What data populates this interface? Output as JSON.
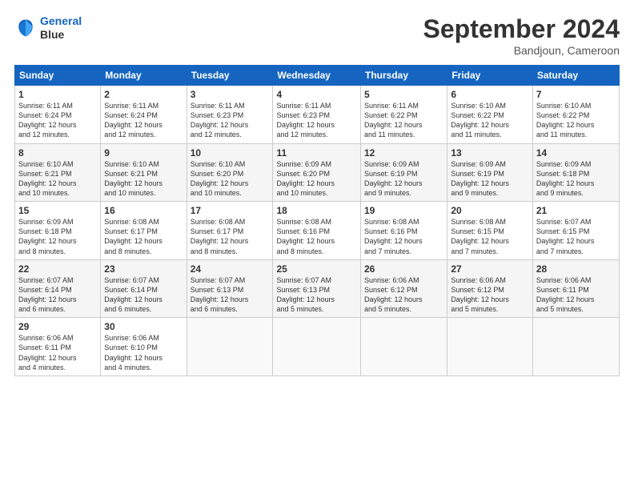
{
  "logo": {
    "line1": "General",
    "line2": "Blue"
  },
  "title": "September 2024",
  "subtitle": "Bandjoun, Cameroon",
  "days_of_week": [
    "Sunday",
    "Monday",
    "Tuesday",
    "Wednesday",
    "Thursday",
    "Friday",
    "Saturday"
  ],
  "weeks": [
    [
      {
        "day": "1",
        "info": "Sunrise: 6:11 AM\nSunset: 6:24 PM\nDaylight: 12 hours\nand 12 minutes."
      },
      {
        "day": "2",
        "info": "Sunrise: 6:11 AM\nSunset: 6:24 PM\nDaylight: 12 hours\nand 12 minutes."
      },
      {
        "day": "3",
        "info": "Sunrise: 6:11 AM\nSunset: 6:23 PM\nDaylight: 12 hours\nand 12 minutes."
      },
      {
        "day": "4",
        "info": "Sunrise: 6:11 AM\nSunset: 6:23 PM\nDaylight: 12 hours\nand 12 minutes."
      },
      {
        "day": "5",
        "info": "Sunrise: 6:11 AM\nSunset: 6:22 PM\nDaylight: 12 hours\nand 11 minutes."
      },
      {
        "day": "6",
        "info": "Sunrise: 6:10 AM\nSunset: 6:22 PM\nDaylight: 12 hours\nand 11 minutes."
      },
      {
        "day": "7",
        "info": "Sunrise: 6:10 AM\nSunset: 6:22 PM\nDaylight: 12 hours\nand 11 minutes."
      }
    ],
    [
      {
        "day": "8",
        "info": "Sunrise: 6:10 AM\nSunset: 6:21 PM\nDaylight: 12 hours\nand 10 minutes."
      },
      {
        "day": "9",
        "info": "Sunrise: 6:10 AM\nSunset: 6:21 PM\nDaylight: 12 hours\nand 10 minutes."
      },
      {
        "day": "10",
        "info": "Sunrise: 6:10 AM\nSunset: 6:20 PM\nDaylight: 12 hours\nand 10 minutes."
      },
      {
        "day": "11",
        "info": "Sunrise: 6:09 AM\nSunset: 6:20 PM\nDaylight: 12 hours\nand 10 minutes."
      },
      {
        "day": "12",
        "info": "Sunrise: 6:09 AM\nSunset: 6:19 PM\nDaylight: 12 hours\nand 9 minutes."
      },
      {
        "day": "13",
        "info": "Sunrise: 6:09 AM\nSunset: 6:19 PM\nDaylight: 12 hours\nand 9 minutes."
      },
      {
        "day": "14",
        "info": "Sunrise: 6:09 AM\nSunset: 6:18 PM\nDaylight: 12 hours\nand 9 minutes."
      }
    ],
    [
      {
        "day": "15",
        "info": "Sunrise: 6:09 AM\nSunset: 6:18 PM\nDaylight: 12 hours\nand 8 minutes."
      },
      {
        "day": "16",
        "info": "Sunrise: 6:08 AM\nSunset: 6:17 PM\nDaylight: 12 hours\nand 8 minutes."
      },
      {
        "day": "17",
        "info": "Sunrise: 6:08 AM\nSunset: 6:17 PM\nDaylight: 12 hours\nand 8 minutes."
      },
      {
        "day": "18",
        "info": "Sunrise: 6:08 AM\nSunset: 6:16 PM\nDaylight: 12 hours\nand 8 minutes."
      },
      {
        "day": "19",
        "info": "Sunrise: 6:08 AM\nSunset: 6:16 PM\nDaylight: 12 hours\nand 7 minutes."
      },
      {
        "day": "20",
        "info": "Sunrise: 6:08 AM\nSunset: 6:15 PM\nDaylight: 12 hours\nand 7 minutes."
      },
      {
        "day": "21",
        "info": "Sunrise: 6:07 AM\nSunset: 6:15 PM\nDaylight: 12 hours\nand 7 minutes."
      }
    ],
    [
      {
        "day": "22",
        "info": "Sunrise: 6:07 AM\nSunset: 6:14 PM\nDaylight: 12 hours\nand 6 minutes."
      },
      {
        "day": "23",
        "info": "Sunrise: 6:07 AM\nSunset: 6:14 PM\nDaylight: 12 hours\nand 6 minutes."
      },
      {
        "day": "24",
        "info": "Sunrise: 6:07 AM\nSunset: 6:13 PM\nDaylight: 12 hours\nand 6 minutes."
      },
      {
        "day": "25",
        "info": "Sunrise: 6:07 AM\nSunset: 6:13 PM\nDaylight: 12 hours\nand 5 minutes."
      },
      {
        "day": "26",
        "info": "Sunrise: 6:06 AM\nSunset: 6:12 PM\nDaylight: 12 hours\nand 5 minutes."
      },
      {
        "day": "27",
        "info": "Sunrise: 6:06 AM\nSunset: 6:12 PM\nDaylight: 12 hours\nand 5 minutes."
      },
      {
        "day": "28",
        "info": "Sunrise: 6:06 AM\nSunset: 6:11 PM\nDaylight: 12 hours\nand 5 minutes."
      }
    ],
    [
      {
        "day": "29",
        "info": "Sunrise: 6:06 AM\nSunset: 6:11 PM\nDaylight: 12 hours\nand 4 minutes."
      },
      {
        "day": "30",
        "info": "Sunrise: 6:06 AM\nSunset: 6:10 PM\nDaylight: 12 hours\nand 4 minutes."
      },
      {
        "day": "",
        "info": ""
      },
      {
        "day": "",
        "info": ""
      },
      {
        "day": "",
        "info": ""
      },
      {
        "day": "",
        "info": ""
      },
      {
        "day": "",
        "info": ""
      }
    ]
  ]
}
